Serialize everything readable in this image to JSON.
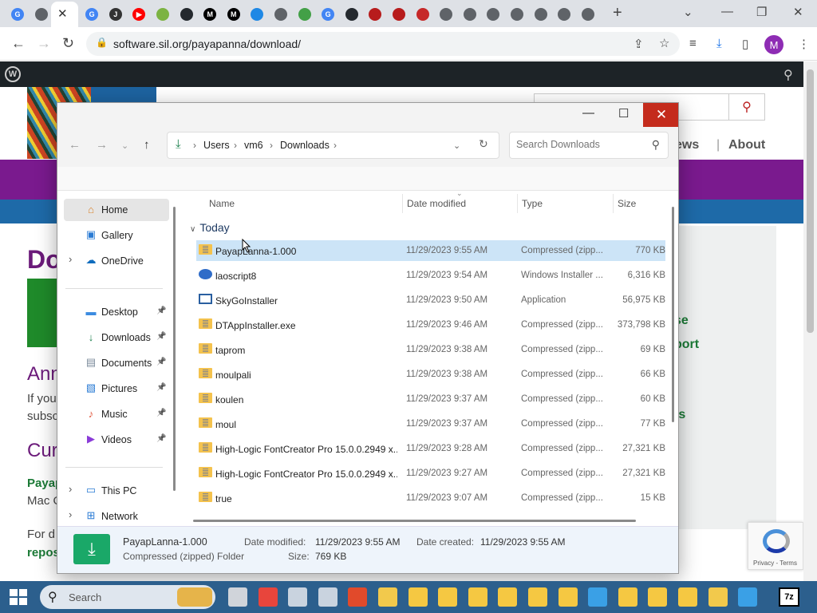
{
  "browser": {
    "url": "software.sil.org/payapanna/download/",
    "close_tab_glyph": "✕",
    "new_tab_glyph": "+",
    "tabs": [
      {
        "icon": "google-icon",
        "letter": "G",
        "color": "#4285f4"
      },
      {
        "icon": "globe-icon",
        "letter": "",
        "color": "#5f6368"
      },
      {
        "icon": "google-icon",
        "letter": "G",
        "color": "#4285f4"
      },
      {
        "icon": "script-icon",
        "letter": "J",
        "color": "#333333"
      },
      {
        "icon": "youtube-icon",
        "letter": "▶",
        "color": "#ff0000"
      },
      {
        "icon": "leaf-icon",
        "letter": "",
        "color": "#7cb342"
      },
      {
        "icon": "github-icon",
        "letter": "",
        "color": "#24292e"
      },
      {
        "icon": "medium-icon",
        "letter": "M",
        "color": "#000000"
      },
      {
        "icon": "medium-icon",
        "letter": "M",
        "color": "#000000"
      },
      {
        "icon": "flag-icon",
        "letter": "",
        "color": "#1e88e5"
      },
      {
        "icon": "globe-icon",
        "letter": "",
        "color": "#5f6368"
      },
      {
        "icon": "stripe-icon",
        "letter": "",
        "color": "#43a047"
      },
      {
        "icon": "google-icon",
        "letter": "G",
        "color": "#4285f4"
      },
      {
        "icon": "github-icon",
        "letter": "",
        "color": "#24292e"
      },
      {
        "icon": "bug-icon",
        "letter": "",
        "color": "#b71c1c"
      },
      {
        "icon": "bug-icon",
        "letter": "",
        "color": "#b71c1c"
      },
      {
        "icon": "disc-icon",
        "letter": "",
        "color": "#c62828"
      },
      {
        "icon": "chrome-icon",
        "letter": "",
        "color": "#5f6368"
      },
      {
        "icon": "chrome-icon",
        "letter": "",
        "color": "#5f6368"
      },
      {
        "icon": "chrome-icon",
        "letter": "",
        "color": "#5f6368"
      },
      {
        "icon": "chrome-icon",
        "letter": "",
        "color": "#5f6368"
      },
      {
        "icon": "chrome-icon",
        "letter": "",
        "color": "#5f6368"
      },
      {
        "icon": "speaker-icon",
        "letter": "",
        "color": "#5f6368"
      },
      {
        "icon": "chrome-icon",
        "letter": "",
        "color": "#5f6368"
      }
    ],
    "profile_initial": "M"
  },
  "website": {
    "nav_items": [
      "ews",
      "About"
    ],
    "heading": "Do",
    "side_links": [
      "se",
      "port",
      "ts"
    ],
    "headings2": [
      "Ann",
      "Cur"
    ],
    "paragraphs": [
      "If you",
      "subsc",
      "Mac O",
      "For d"
    ],
    "links": [
      "Payap",
      "repos"
    ],
    "recaptcha_text": "Privacy - Terms",
    "brand_color": "#7a1a8e"
  },
  "explorer": {
    "title_buttons": {
      "minimize": "—",
      "maximize": "☐",
      "close": "✕"
    },
    "breadcrumb": [
      "Users",
      "vm6",
      "Downloads"
    ],
    "search_placeholder": "Search Downloads",
    "nav": [
      {
        "label": "Home",
        "icon": "home-icon",
        "glyph": "⌂",
        "color": "#d9822b",
        "selected": true,
        "pinned": false,
        "expandable": false
      },
      {
        "label": "Gallery",
        "icon": "gallery-icon",
        "glyph": "▣",
        "color": "#2a7bd4",
        "selected": false,
        "pinned": false,
        "expandable": false
      },
      {
        "label": "OneDrive",
        "icon": "cloud-icon",
        "glyph": "☁",
        "color": "#0f6cbd",
        "selected": false,
        "pinned": false,
        "expandable": true
      },
      {
        "label": "Desktop",
        "icon": "desktop-icon",
        "glyph": "▬",
        "color": "#3b8be0",
        "selected": false,
        "pinned": true,
        "expandable": false
      },
      {
        "label": "Downloads",
        "icon": "download-icon",
        "glyph": "↓",
        "color": "#1a7f4b",
        "selected": false,
        "pinned": true,
        "expandable": false
      },
      {
        "label": "Documents",
        "icon": "document-icon",
        "glyph": "▤",
        "color": "#7a8a9a",
        "selected": false,
        "pinned": true,
        "expandable": false
      },
      {
        "label": "Pictures",
        "icon": "pictures-icon",
        "glyph": "▧",
        "color": "#2a7bd4",
        "selected": false,
        "pinned": true,
        "expandable": false
      },
      {
        "label": "Music",
        "icon": "music-icon",
        "glyph": "♪",
        "color": "#e0553b",
        "selected": false,
        "pinned": true,
        "expandable": false
      },
      {
        "label": "Videos",
        "icon": "videos-icon",
        "glyph": "▶",
        "color": "#8a3bd8",
        "selected": false,
        "pinned": true,
        "expandable": false
      },
      {
        "label": "This PC",
        "icon": "computer-icon",
        "glyph": "▭",
        "color": "#2a7bd4",
        "selected": false,
        "pinned": false,
        "expandable": true
      },
      {
        "label": "Network",
        "icon": "network-icon",
        "glyph": "⊞",
        "color": "#2a7bd4",
        "selected": false,
        "pinned": false,
        "expandable": true
      }
    ],
    "columns": {
      "name": "Name",
      "date": "Date modified",
      "type": "Type",
      "size": "Size"
    },
    "group": "Today",
    "files": [
      {
        "name": "PayapLanna-1.000",
        "date": "11/29/2023 9:55 AM",
        "type": "Compressed (zipp...",
        "size": "770 KB",
        "icon": "zip",
        "selected": true
      },
      {
        "name": "laoscript8",
        "date": "11/29/2023 9:54 AM",
        "type": "Windows Installer ...",
        "size": "6,316 KB",
        "icon": "msi",
        "selected": false
      },
      {
        "name": "SkyGoInstaller",
        "date": "11/29/2023 9:50 AM",
        "type": "Application",
        "size": "56,975 KB",
        "icon": "app",
        "selected": false
      },
      {
        "name": "DTAppInstaller.exe",
        "date": "11/29/2023 9:46 AM",
        "type": "Compressed (zipp...",
        "size": "373,798 KB",
        "icon": "zip",
        "selected": false
      },
      {
        "name": "taprom",
        "date": "11/29/2023 9:38 AM",
        "type": "Compressed (zipp...",
        "size": "69 KB",
        "icon": "zip",
        "selected": false
      },
      {
        "name": "moulpali",
        "date": "11/29/2023 9:38 AM",
        "type": "Compressed (zipp...",
        "size": "66 KB",
        "icon": "zip",
        "selected": false
      },
      {
        "name": "koulen",
        "date": "11/29/2023 9:37 AM",
        "type": "Compressed (zipp...",
        "size": "60 KB",
        "icon": "zip",
        "selected": false
      },
      {
        "name": "moul",
        "date": "11/29/2023 9:37 AM",
        "type": "Compressed (zipp...",
        "size": "77 KB",
        "icon": "zip",
        "selected": false
      },
      {
        "name": "High-Logic FontCreator Pro 15.0.0.2949 x...",
        "date": "11/29/2023 9:28 AM",
        "type": "Compressed (zipp...",
        "size": "27,321 KB",
        "icon": "zip",
        "selected": false
      },
      {
        "name": "High-Logic FontCreator Pro 15.0.0.2949 x...",
        "date": "11/29/2023 9:27 AM",
        "type": "Compressed (zipp...",
        "size": "27,321 KB",
        "icon": "zip",
        "selected": false
      },
      {
        "name": "true",
        "date": "11/29/2023 9:07 AM",
        "type": "Compressed (zipp...",
        "size": "15 KB",
        "icon": "zip",
        "selected": false
      }
    ],
    "details": {
      "name": "PayapLanna-1.000",
      "kind": "Compressed (zipped) Folder",
      "modified_label": "Date modified:",
      "modified": "11/29/2023 9:55 AM",
      "created_label": "Date created:",
      "created": "11/29/2023 9:55 AM",
      "size_label": "Size:",
      "size": "769 KB"
    }
  },
  "taskbar": {
    "search_label": "Search",
    "apps": [
      {
        "icon": "task-view-icon",
        "color": "#d0d4da"
      },
      {
        "icon": "chrome-icon",
        "color": "#e8453c"
      },
      {
        "icon": "app-icon",
        "color": "#c9d3df"
      },
      {
        "icon": "app-icon",
        "color": "#c9d3df"
      },
      {
        "icon": "maps-pin-icon",
        "color": "#e14a2b"
      },
      {
        "icon": "font-folder-icon",
        "color": "#f2c94c"
      },
      {
        "icon": "folder-icon",
        "color": "#f5c842"
      },
      {
        "icon": "folder-icon",
        "color": "#f5c842"
      },
      {
        "icon": "zip-folder-icon",
        "color": "#f5c842"
      },
      {
        "icon": "zip-folder-icon",
        "color": "#f5c842"
      },
      {
        "icon": "zip-folder-icon",
        "color": "#f5c842"
      },
      {
        "icon": "zip-folder-icon",
        "color": "#f5c842"
      },
      {
        "icon": "download-folder-icon",
        "color": "#3aa0e6"
      },
      {
        "icon": "zip-folder-icon",
        "color": "#f5c842"
      },
      {
        "icon": "zip-folder-icon",
        "color": "#f5c842"
      },
      {
        "icon": "folder-icon",
        "color": "#f5c842"
      },
      {
        "icon": "font-folder-icon",
        "color": "#f2c94c"
      },
      {
        "icon": "download-folder-icon",
        "color": "#3aa0e6"
      }
    ],
    "tray_app": "7z"
  }
}
